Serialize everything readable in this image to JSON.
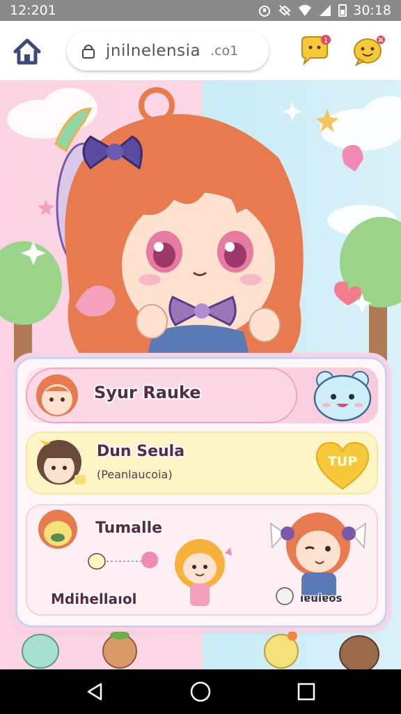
{
  "status_bar": {
    "time_left": "12:201",
    "time_right": "30:18",
    "icons": [
      "alarm-icon",
      "no-sound-icon",
      "wifi-icon",
      "signal-icon",
      "battery-icon"
    ]
  },
  "browser": {
    "url": "jnilnelensia",
    "url_suffix": ".co1",
    "icons": [
      "home-icon",
      "lock-icon",
      "chat-notification-icon",
      "emoji-chat-icon"
    ]
  },
  "cards": [
    {
      "name": "Syur Rauke",
      "badge_icon": "bear-mascot-icon"
    },
    {
      "name": "Dun Seula",
      "subtitle": "(Peanlaucoia)",
      "button_label": "TUP"
    },
    {
      "name": "Tumalle",
      "name_secondary": "Mdihellaıol",
      "badge": "ıɐuiɐos"
    }
  ],
  "colors": {
    "accent_pink": "#f4a3bf",
    "accent_yellow": "#f6c93b",
    "hair": "#e77a4f",
    "bow": "#5b4a9e"
  },
  "nav": [
    "back-icon",
    "home-circle-icon",
    "recents-icon"
  ]
}
